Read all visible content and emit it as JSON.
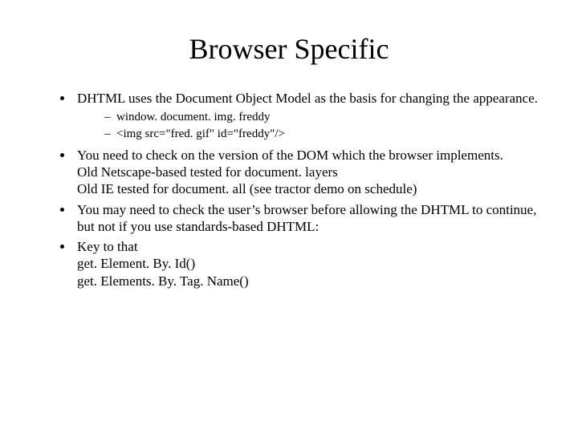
{
  "title": "Browser Specific",
  "bullets": {
    "b1": "DHTML uses the Document Object Model as the basis for changing the appearance.",
    "b1_sub1": "window. document. img. freddy",
    "b1_sub2": "<img src=\"fred. gif\" id=\"freddy\"/>",
    "b2_l1": "You need to check on the version of the DOM which the browser implements.",
    "b2_l2": "Old Netscape-based tested for document. layers",
    "b2_l3": "Old IE tested for document. all (see tractor demo on schedule)",
    "b3": "You may need to check the user’s browser before allowing the DHTML to continue, but not if you use standards-based DHTML:",
    "b4_l1": "Key to that",
    "b4_l2": "get. Element. By. Id()",
    "b4_l3": "get. Elements. By. Tag. Name()"
  }
}
